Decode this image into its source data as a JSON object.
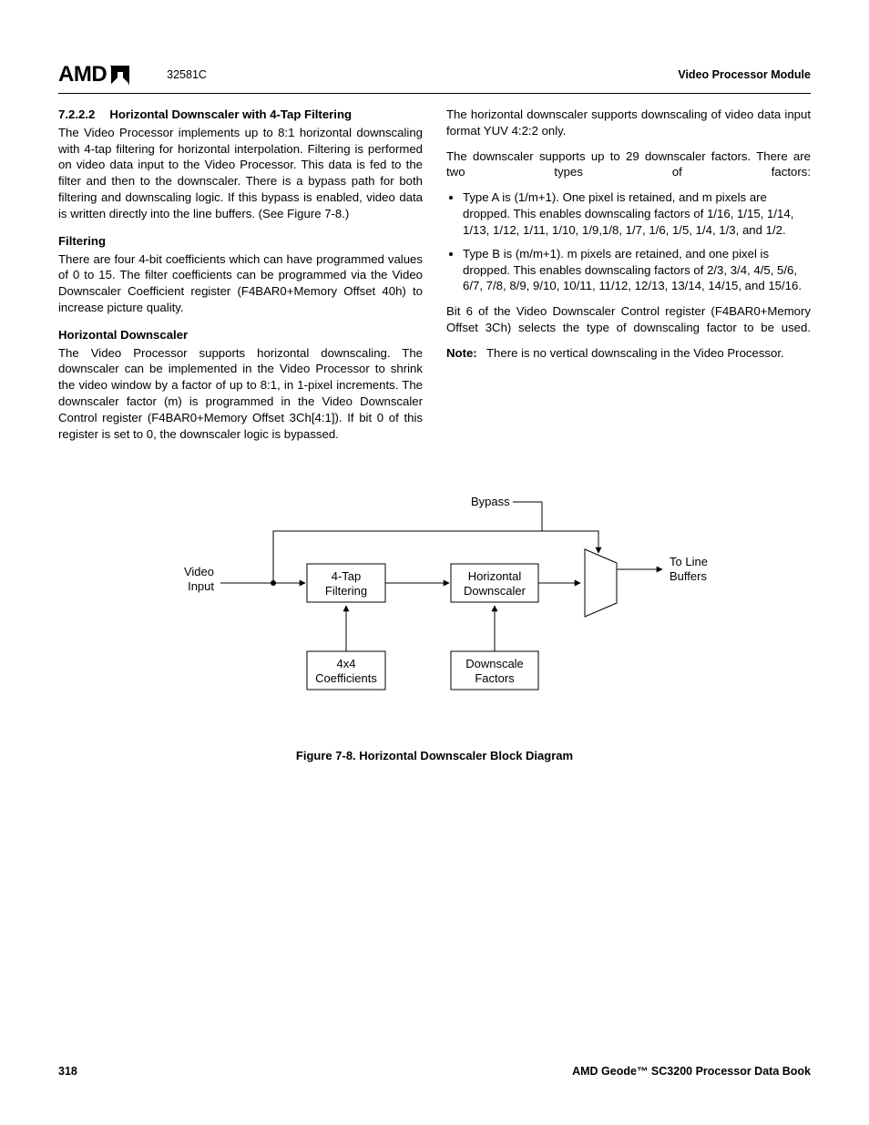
{
  "header": {
    "logo": "AMD",
    "docnum": "32581C",
    "module": "Video Processor Module"
  },
  "left": {
    "sec_num": "7.2.2.2",
    "sec_title": "Horizontal Downscaler with 4-Tap Filtering",
    "p1": "The Video Processor implements up to 8:1 horizontal downscaling with 4-tap filtering for horizontal interpolation. Filtering is performed on video data input to the Video Processor. This data is fed to the filter and then to the downscaler. There is a bypass path for both filtering and downscaling logic. If this bypass is enabled, video data is written directly into the line buffers. (See Figure 7-8.)",
    "h_filtering": "Filtering",
    "p2": "There are four 4-bit coefficients which can have programmed values of 0 to 15. The filter coefficients can be programmed via the Video Downscaler Coefficient register (F4BAR0+Memory Offset 40h) to increase picture quality.",
    "h_hds": "Horizontal Downscaler",
    "p3": "The Video Processor supports horizontal downscaling. The downscaler can be implemented in the Video Processor to shrink the video window by a factor of up to 8:1, in 1-pixel increments. The downscaler factor (m) is programmed in the Video Downscaler Control register (F4BAR0+Memory Offset 3Ch[4:1]). If bit 0 of this register is set to 0, the downscaler logic is bypassed."
  },
  "right": {
    "p1": "The horizontal downscaler supports downscaling of video data input format YUV 4:2:2 only.",
    "p2": "The downscaler supports up to 29 downscaler factors. There are two types of factors:",
    "li1": "Type A is (1/m+1). One pixel is retained, and m pixels are dropped. This enables downscaling factors of 1/16, 1/15, 1/14, 1/13, 1/12, 1/11, 1/10, 1/9,1/8, 1/7, 1/6, 1/5, 1/4, 1/3, and 1/2.",
    "li2": "Type B is (m/m+1). m pixels are retained, and one pixel is dropped. This enables downscaling factors of 2/3, 3/4, 4/5, 5/6, 6/7, 7/8, 8/9, 9/10, 10/11, 11/12, 12/13, 13/14, 14/15, and 15/16.",
    "p3": "Bit 6 of the Video Downscaler Control register (F4BAR0+Memory Offset 3Ch) selects the type of downscaling factor to be used.",
    "note_lbl": "Note:",
    "note_txt": "There is no vertical downscaling in the Video Processor."
  },
  "diagram": {
    "bypass": "Bypass",
    "video": "Video",
    "input": "Input",
    "tap1": "4-Tap",
    "tap2": "Filtering",
    "hd1": "Horizontal",
    "hd2": "Downscaler",
    "coef1": "4x4",
    "coef2": "Coefficients",
    "df1": "Downscale",
    "df2": "Factors",
    "out1": "To Line",
    "out2": "Buffers"
  },
  "figure_caption": "Figure 7-8.  Horizontal Downscaler Block Diagram",
  "footer": {
    "page": "318",
    "book": "AMD Geode™ SC3200 Processor Data Book"
  }
}
